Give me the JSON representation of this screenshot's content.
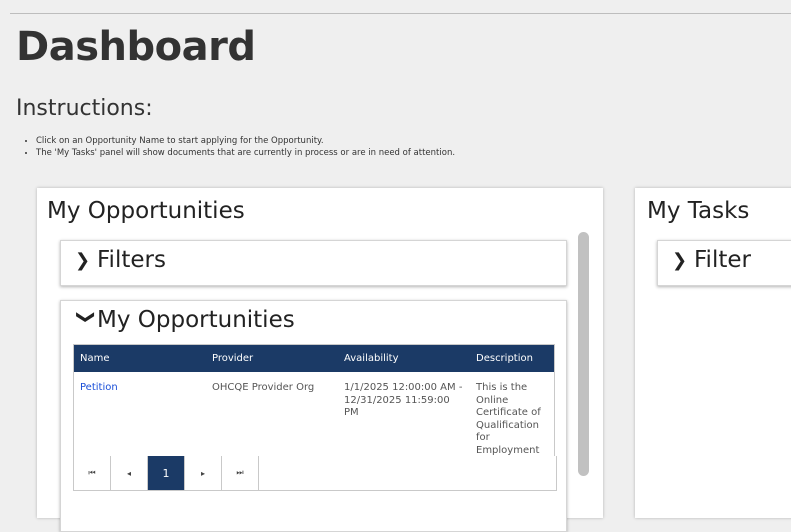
{
  "page": {
    "title": "Dashboard"
  },
  "instructions": {
    "heading": "Instructions:",
    "items": [
      "Click on an Opportunity Name to start applying for the Opportunity.",
      "The 'My Tasks' panel will show documents that are currently in process or are in need of attention."
    ]
  },
  "opportunities_panel": {
    "title": "My Opportunities",
    "filters_label": "Filters",
    "list_title": "My Opportunities",
    "columns": [
      "Name",
      "Provider",
      "Availability",
      "Description"
    ],
    "rows": [
      {
        "name": "Petition",
        "provider": "OHCQE Provider Org",
        "availability": "1/1/2025 12:00:00 AM - 12/31/2025 11:59:00 PM",
        "description": "This is the Online Certificate of Qualification for Employment Petition."
      }
    ],
    "pager": {
      "first": "⏮",
      "prev": "◂",
      "current_page": "1",
      "next": "▸",
      "last": "⏭"
    }
  },
  "tasks_panel": {
    "title": "My Tasks",
    "filter_label": "Filter"
  },
  "colors": {
    "table_header_bg": "#1b3a66",
    "link": "#1a4fd8",
    "page_bg": "#efefef"
  },
  "icons": {
    "collapsed": "chevron-right-icon",
    "expanded": "chevron-down-icon"
  }
}
